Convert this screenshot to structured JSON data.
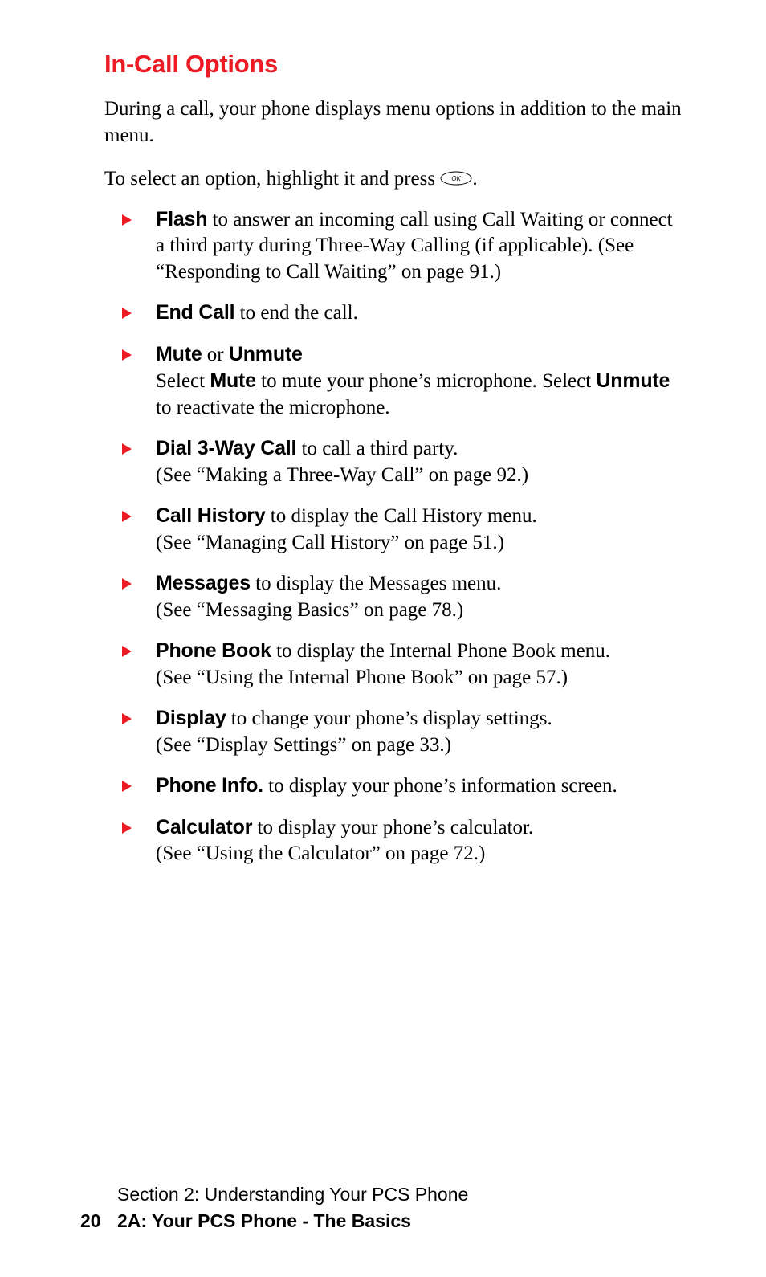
{
  "heading": "In-Call Options",
  "intro": "During a call, your phone displays menu options in addition to the main menu.",
  "lead_before": "To select an option, highlight it and press ",
  "lead_after": ".",
  "ok_label": "OK",
  "items": [
    {
      "label": "Flash",
      "rest": " to answer an incoming call using Call Waiting or connect a third party during Three-Way Calling (if applicable). (See “Responding to Call Waiting” on page 91.)"
    },
    {
      "label": "End Call",
      "rest": " to end the call."
    },
    {
      "label": "Mute",
      "mid": " or ",
      "label2": "Unmute",
      "rest_pre": "Select ",
      "label3": "Mute",
      "rest_mid": " to mute your phone’s microphone. Select ",
      "label4": "Unmute",
      "rest_end": " to reactivate the microphone."
    },
    {
      "label": "Dial 3-Way Call",
      "rest": " to call a third party.\n(See “Making a Three-Way Call” on page 92.)"
    },
    {
      "label": "Call History",
      "rest": " to display the Call History menu.\n(See “Managing Call History” on page 51.)"
    },
    {
      "label": "Messages",
      "rest": " to display the Messages menu.\n(See “Messaging Basics” on page 78.)"
    },
    {
      "label": "Phone Book",
      "rest": " to display the Internal Phone Book menu.\n(See “Using the Internal Phone Book” on page 57.)"
    },
    {
      "label": "Display",
      "rest": " to change your phone’s display settings.\n(See “Display Settings” on page 33.)"
    },
    {
      "label": "Phone Info.",
      "rest": " to display your phone’s information screen."
    },
    {
      "label": "Calculator",
      "rest": " to display your phone’s calculator.\n(See “Using the Calculator” on page 72.)"
    }
  ],
  "footer": {
    "section": "Section 2: Understanding Your PCS Phone",
    "page_number": "20",
    "chapter": "2A: Your PCS Phone - The Basics"
  }
}
